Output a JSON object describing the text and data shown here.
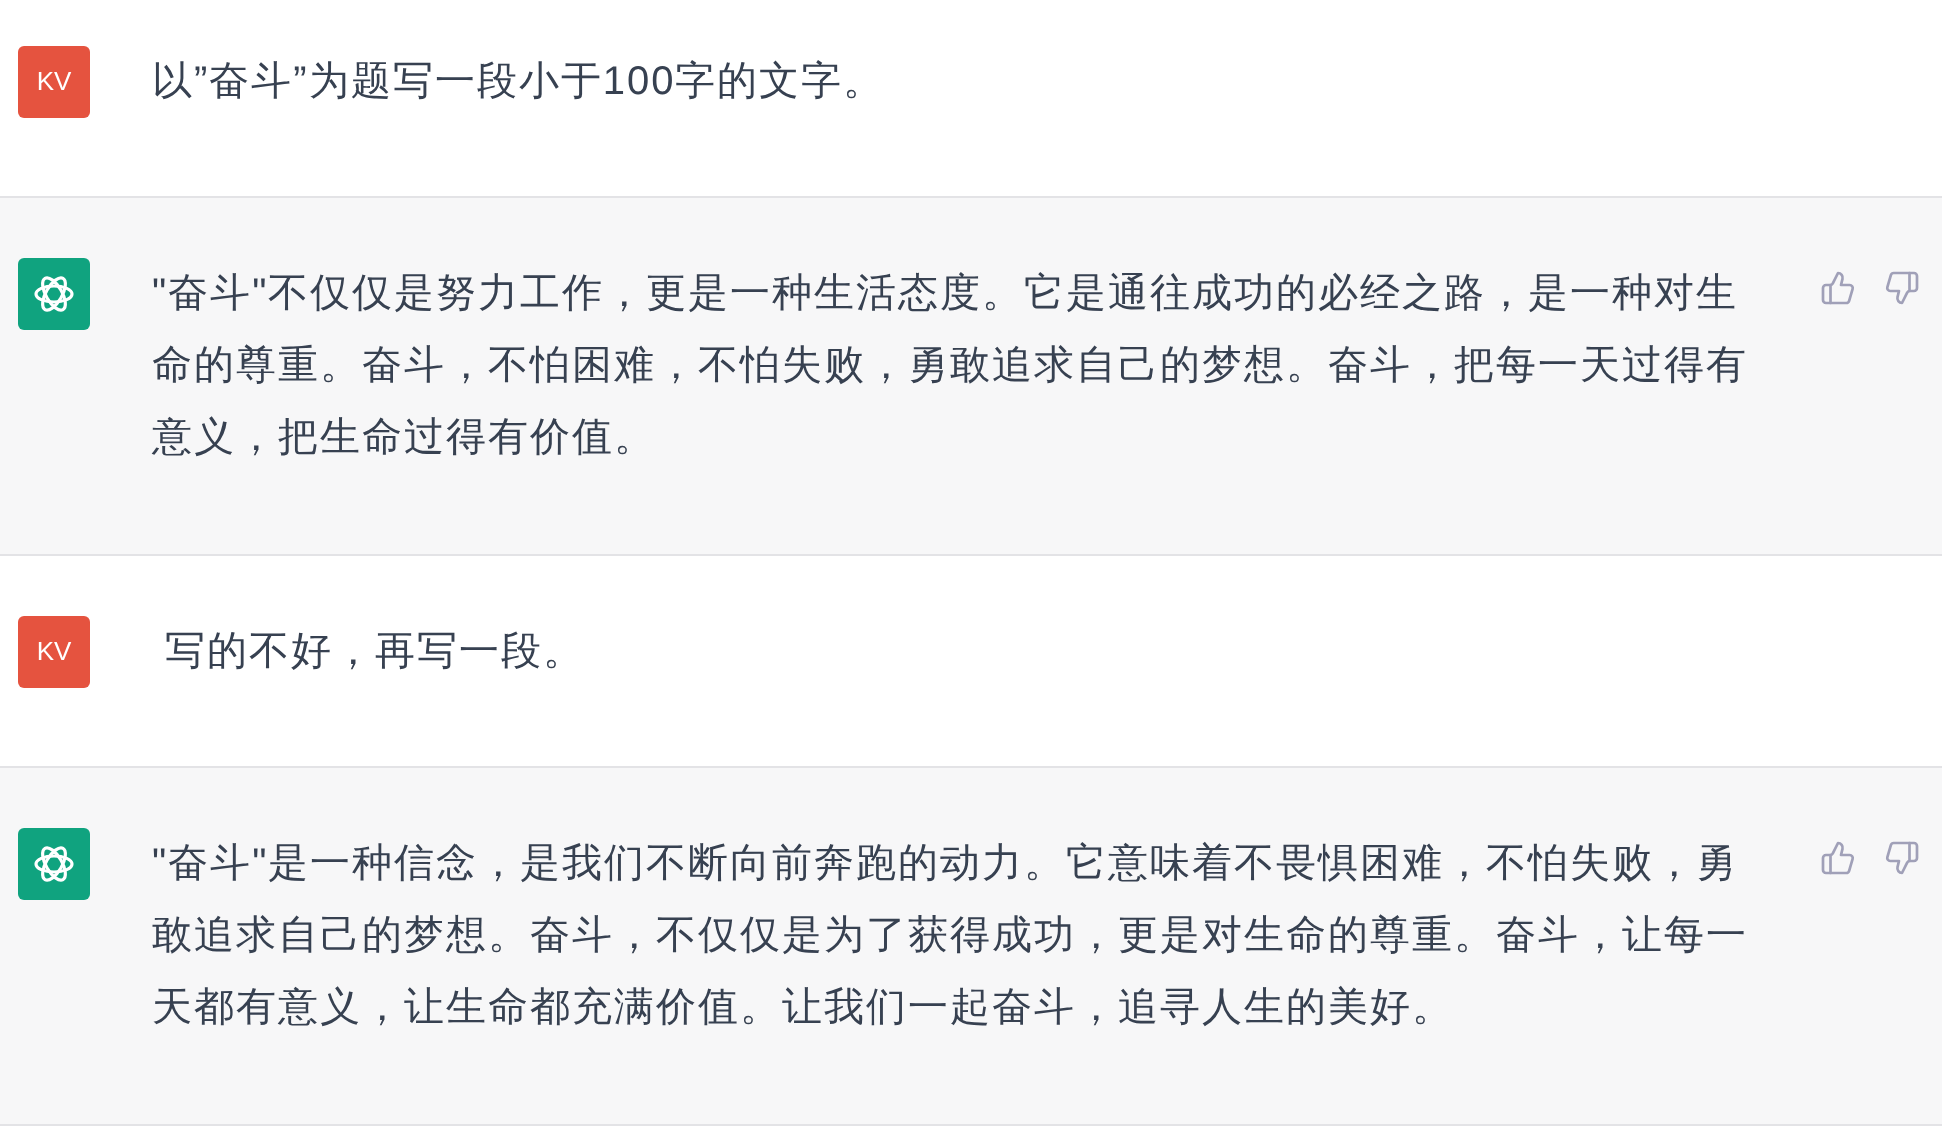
{
  "messages": [
    {
      "kind": "user",
      "avatar": "KV",
      "text": "以”奋斗”为题写一段小于100字的文字。"
    },
    {
      "kind": "assistant",
      "text": "\"奋斗\"不仅仅是努力工作，更是一种生活态度。它是通往成功的必经之路，是一种对生命的尊重。奋斗，不怕困难，不怕失败，勇敢追求自己的梦想。奋斗，把每一天过得有意义，把生命过得有价值。"
    },
    {
      "kind": "user",
      "avatar": "KV",
      "text": " 写的不好，再写一段。"
    },
    {
      "kind": "assistant",
      "text": "\"奋斗\"是一种信念，是我们不断向前奔跑的动力。它意味着不畏惧困难，不怕失败，勇敢追求自己的梦想。奋斗，不仅仅是为了获得成功，更是对生命的尊重。奋斗，让每一天都有意义，让生命都充满价值。让我们一起奋斗，追寻人生的美好。"
    }
  ]
}
